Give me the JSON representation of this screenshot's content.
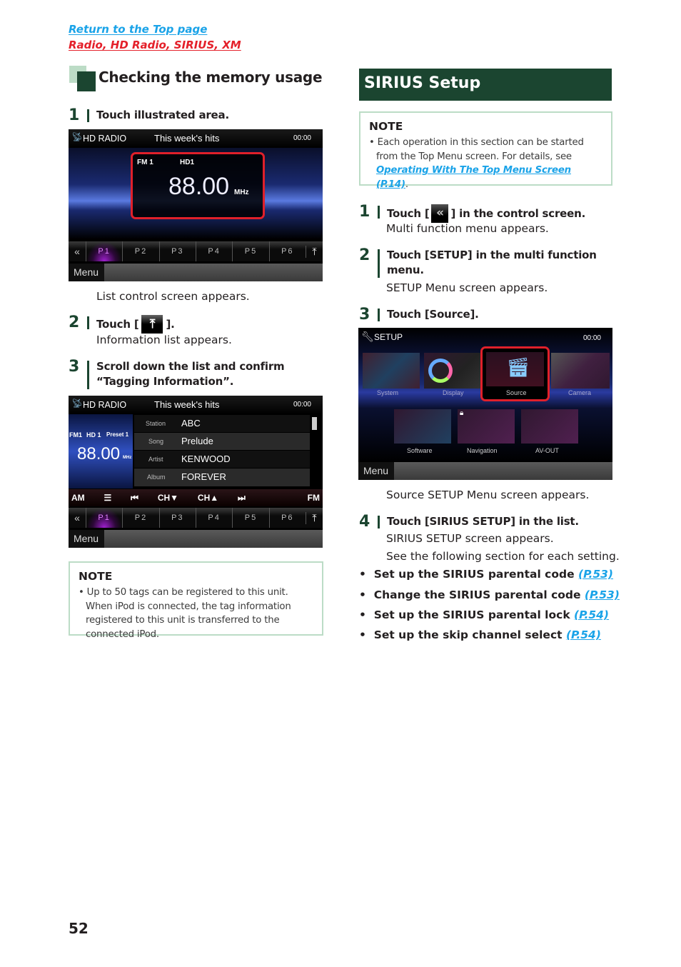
{
  "header": {
    "top_link": "Return to the Top page",
    "category_link": "Radio, HD Radio, SIRIUS, XM"
  },
  "left": {
    "section_title": "Checking the memory usage",
    "steps": [
      {
        "num": "1",
        "text": "Touch illustrated area.",
        "result": "List control screen appears."
      },
      {
        "num": "2",
        "text_before": "Touch [",
        "text_after": "].",
        "icon": "info-list-icon",
        "result": "Information list appears."
      },
      {
        "num": "3",
        "text": "Scroll down the list and confirm “Tagging Information”."
      }
    ],
    "screen1": {
      "source": "HD RADIO",
      "title": "This week's hits",
      "clock": "00:00",
      "band": "FM 1",
      "channel": "HD1",
      "frequency": "88.00",
      "unit": "MHz",
      "presets": [
        "P1",
        "P2",
        "P3",
        "P4",
        "P5",
        "P6"
      ],
      "active_preset": "P1",
      "menu": "Menu"
    },
    "screen2": {
      "source": "HD RADIO",
      "title": "This week's hits",
      "clock": "00:00",
      "band": "FM1",
      "channel": "HD 1",
      "preset_label": "Preset 1",
      "frequency": "88.00",
      "unit": "MHz",
      "info_rows": [
        {
          "label": "Station",
          "value": "ABC"
        },
        {
          "label": "Song",
          "value": "Prelude"
        },
        {
          "label": "Artist",
          "value": "KENWOOD"
        },
        {
          "label": "Album",
          "value": "FOREVER"
        }
      ],
      "controls": [
        "AM",
        "☰",
        "⏮",
        "CH▼",
        "CH▲",
        "⏭",
        "FM"
      ],
      "presets": [
        "P1",
        "P2",
        "P3",
        "P4",
        "P5",
        "P6"
      ],
      "active_preset": "P1",
      "menu": "Menu"
    },
    "note": {
      "title": "NOTE",
      "text": "Up to 50 tags can be registered to this unit. When iPod is connected, the tag information registered to this unit is transferred to the connected iPod."
    }
  },
  "right": {
    "section_title": "SIRIUS Setup",
    "note": {
      "title": "NOTE",
      "text_before": "Each operation in this section can be started from the Top Menu screen. For details, see ",
      "link": "Operating With The Top Menu Screen (P.14)",
      "text_after": "."
    },
    "steps": [
      {
        "num": "1",
        "text_before": "Touch [",
        "text_after": "] in the control screen.",
        "icon": "multi-function-chevron-icon",
        "result": "Multi function menu appears."
      },
      {
        "num": "2",
        "text": "Touch [SETUP] in the multi function menu.",
        "result": "SETUP Menu screen appears."
      },
      {
        "num": "3",
        "text": "Touch [Source].",
        "result": "Source SETUP Menu screen appears."
      },
      {
        "num": "4",
        "text": "Touch [SIRIUS SETUP] in the list.",
        "result": "SIRIUS SETUP screen appears.",
        "result2": "See the following section for each setting."
      }
    ],
    "setup_screen": {
      "title": "SETUP",
      "clock": "00:00",
      "tiles_row1": [
        "System",
        "Display",
        "Source",
        "Camera"
      ],
      "tiles_row2": [
        "Software",
        "Navigation",
        "AV-OUT"
      ],
      "highlighted": "Source",
      "menu": "Menu"
    },
    "bullets": [
      {
        "text": "Set up the SIRIUS parental code ",
        "link": "(P.53)"
      },
      {
        "text": "Change the SIRIUS parental code ",
        "link": "(P.53)"
      },
      {
        "text": "Set up the SIRIUS parental lock ",
        "link": "(P.54)"
      },
      {
        "text": "Set up the skip channel select ",
        "link": "(P.54)"
      }
    ]
  },
  "footer": {
    "page_number": "52"
  },
  "colors": {
    "accent_green": "#1b4530",
    "light_green": "#bcdcc6",
    "link_blue": "#1aa3e8",
    "link_red": "#e4202a",
    "highlight_red": "#e0202a"
  }
}
